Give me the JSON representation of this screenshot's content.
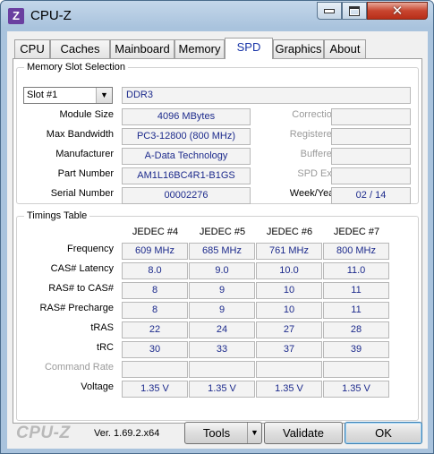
{
  "window": {
    "app_icon_letter": "Z",
    "title": "CPU-Z",
    "close_glyph": "✕"
  },
  "tabs": [
    {
      "label": "CPU"
    },
    {
      "label": "Caches"
    },
    {
      "label": "Mainboard"
    },
    {
      "label": "Memory"
    },
    {
      "label": "SPD",
      "active": true
    },
    {
      "label": "Graphics"
    },
    {
      "label": "About"
    }
  ],
  "slot_selection": {
    "group_title": "Memory Slot Selection",
    "slot_value": "Slot #1",
    "memory_type": "DDR3",
    "rows": {
      "module_size": {
        "label": "Module Size",
        "value": "4096 MBytes"
      },
      "max_bandwidth": {
        "label": "Max Bandwidth",
        "value": "PC3-12800 (800 MHz)"
      },
      "manufacturer": {
        "label": "Manufacturer",
        "value": "A-Data Technology"
      },
      "part_number": {
        "label": "Part Number",
        "value": "AM1L16BC4R1-B1GS"
      },
      "serial_number": {
        "label": "Serial Number",
        "value": "00002276"
      }
    },
    "right": {
      "correction": {
        "label": "Correction",
        "value": ""
      },
      "registered": {
        "label": "Registered",
        "value": ""
      },
      "buffered": {
        "label": "Buffered",
        "value": ""
      },
      "spd_ext": {
        "label": "SPD Ext.",
        "value": ""
      },
      "week_year": {
        "label": "Week/Year",
        "value": "02 / 14"
      }
    }
  },
  "timings": {
    "group_title": "Timings Table",
    "columns": [
      "JEDEC #4",
      "JEDEC #5",
      "JEDEC #6",
      "JEDEC #7"
    ],
    "rows": [
      {
        "label": "Frequency",
        "values": [
          "609 MHz",
          "685 MHz",
          "761 MHz",
          "800 MHz"
        ]
      },
      {
        "label": "CAS# Latency",
        "values": [
          "8.0",
          "9.0",
          "10.0",
          "11.0"
        ]
      },
      {
        "label": "RAS# to CAS#",
        "values": [
          "8",
          "9",
          "10",
          "11"
        ]
      },
      {
        "label": "RAS# Precharge",
        "values": [
          "8",
          "9",
          "10",
          "11"
        ]
      },
      {
        "label": "tRAS",
        "values": [
          "22",
          "24",
          "27",
          "28"
        ]
      },
      {
        "label": "tRC",
        "values": [
          "30",
          "33",
          "37",
          "39"
        ]
      },
      {
        "label": "Command Rate",
        "values": [
          "",
          "",
          "",
          ""
        ],
        "dim": true
      },
      {
        "label": "Voltage",
        "values": [
          "1.35 V",
          "1.35 V",
          "1.35 V",
          "1.35 V"
        ]
      }
    ]
  },
  "footer": {
    "logo": "CPU-Z",
    "version": "Ver. 1.69.2.x64",
    "tools_label": "Tools",
    "validate_label": "Validate",
    "ok_label": "OK"
  }
}
